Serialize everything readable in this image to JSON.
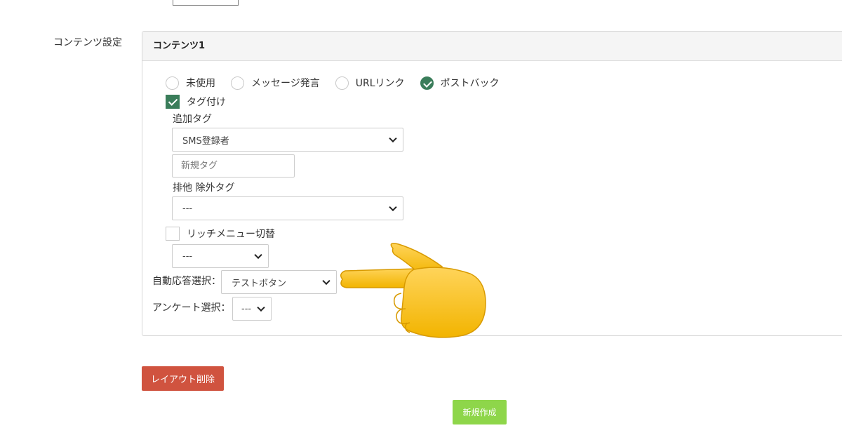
{
  "section": {
    "label": "コンテンツ設定"
  },
  "panel": {
    "title": "コンテンツ1",
    "action_types": [
      {
        "label": "未使用",
        "checked": false
      },
      {
        "label": "メッセージ発言",
        "checked": false
      },
      {
        "label": "URLリンク",
        "checked": false
      },
      {
        "label": "ポストバック",
        "checked": true
      }
    ],
    "tagging": {
      "label": "タグ付け",
      "checked": true,
      "add_tag_label": "追加タグ",
      "add_tag_value": "SMS登録者",
      "new_tag_placeholder": "新規タグ",
      "exclude_tag_label": "排他 除外タグ",
      "exclude_tag_value": "---"
    },
    "rich_menu": {
      "label": "リッチメニュー切替",
      "checked": false,
      "value": "---"
    },
    "auto_reply": {
      "label": "自動応答選択：",
      "value": "テストボタン"
    },
    "survey": {
      "label": "アンケート選択：",
      "value": "---"
    }
  },
  "buttons": {
    "delete_layout": "レイアウト削除",
    "create_new": "新規作成"
  },
  "colors": {
    "accent_green": "#3a7d5a",
    "delete_red": "#d0533f",
    "create_green": "#8ed64a"
  },
  "icons": {
    "pointer": "pointing-hand-icon"
  }
}
